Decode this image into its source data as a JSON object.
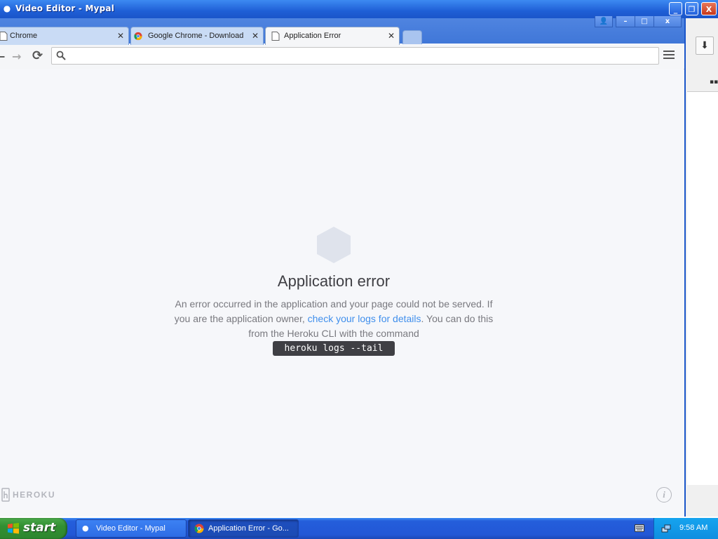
{
  "xp_window": {
    "title": "Video Editor - Mypal",
    "buttons": {
      "minimize": "_",
      "restore": "❐",
      "close": "X"
    }
  },
  "chrome_controls": {
    "profile": "👤",
    "minimize": "–",
    "maximize": "□",
    "close": "x"
  },
  "tabs": [
    {
      "label": "Chrome",
      "close": "✕"
    },
    {
      "label": "Google Chrome - Download t",
      "close": "✕"
    },
    {
      "label": "Application Error",
      "close": "✕"
    }
  ],
  "toolbar": {
    "back": "←",
    "forward": "→",
    "reload": "⟳",
    "omnibox_value": "",
    "omnibox_placeholder": ""
  },
  "page": {
    "title": "Application error",
    "body_1": "An error occurred in the application and your page could not be served. If you are the application owner, ",
    "link": "check your logs for details",
    "body_2": ". You can do this from the Heroku CLI with the command",
    "command": "heroku logs --tail",
    "brand": "HEROKU",
    "info": "i"
  },
  "taskbar": {
    "start": "start",
    "items": [
      {
        "label": "Video Editor - Mypal"
      },
      {
        "label": "Application Error - Go..."
      }
    ],
    "clock": "9:58 AM"
  },
  "colors": {
    "xp_blue": "#245edb",
    "start_green": "#328f32",
    "heroku_link": "#408fec",
    "command_bg": "#3f3f44"
  }
}
